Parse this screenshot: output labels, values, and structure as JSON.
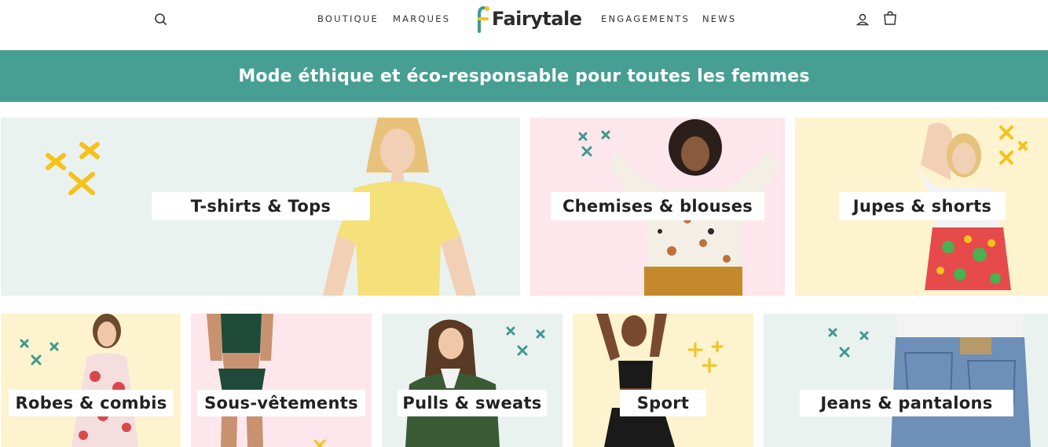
{
  "header": {
    "nav_left": [
      "BOUTIQUE",
      "MARQUES"
    ],
    "nav_right": [
      "ENGAGEMENTS",
      "NEWS"
    ],
    "logo": "Fairytale",
    "icons": [
      "search-icon",
      "account-icon",
      "cart-icon"
    ]
  },
  "banner": {
    "text": "Mode éthique et éco-responsable pour toutes les femmes"
  },
  "categories": [
    {
      "label": "T-shirts & Tops",
      "bg": "#eaf2f0"
    },
    {
      "label": "Chemises & blouses",
      "bg": "#fde6ec"
    },
    {
      "label": "Jupes & shorts",
      "bg": "#fdf3cf"
    },
    {
      "label": "Robes & combis",
      "bg": "#fdf3cf"
    },
    {
      "label": "Sous-vêtements",
      "bg": "#fde6ec"
    },
    {
      "label": "Pulls & sweats",
      "bg": "#eaf2f0"
    },
    {
      "label": "Sport",
      "bg": "#fdf3cf"
    },
    {
      "label": "Jeans & pantalons",
      "bg": "#eaf2f0"
    }
  ],
  "colors": {
    "accent": "#479f93",
    "yellow_star": "#f6c21a",
    "teal_cross": "#3f9a8c"
  }
}
